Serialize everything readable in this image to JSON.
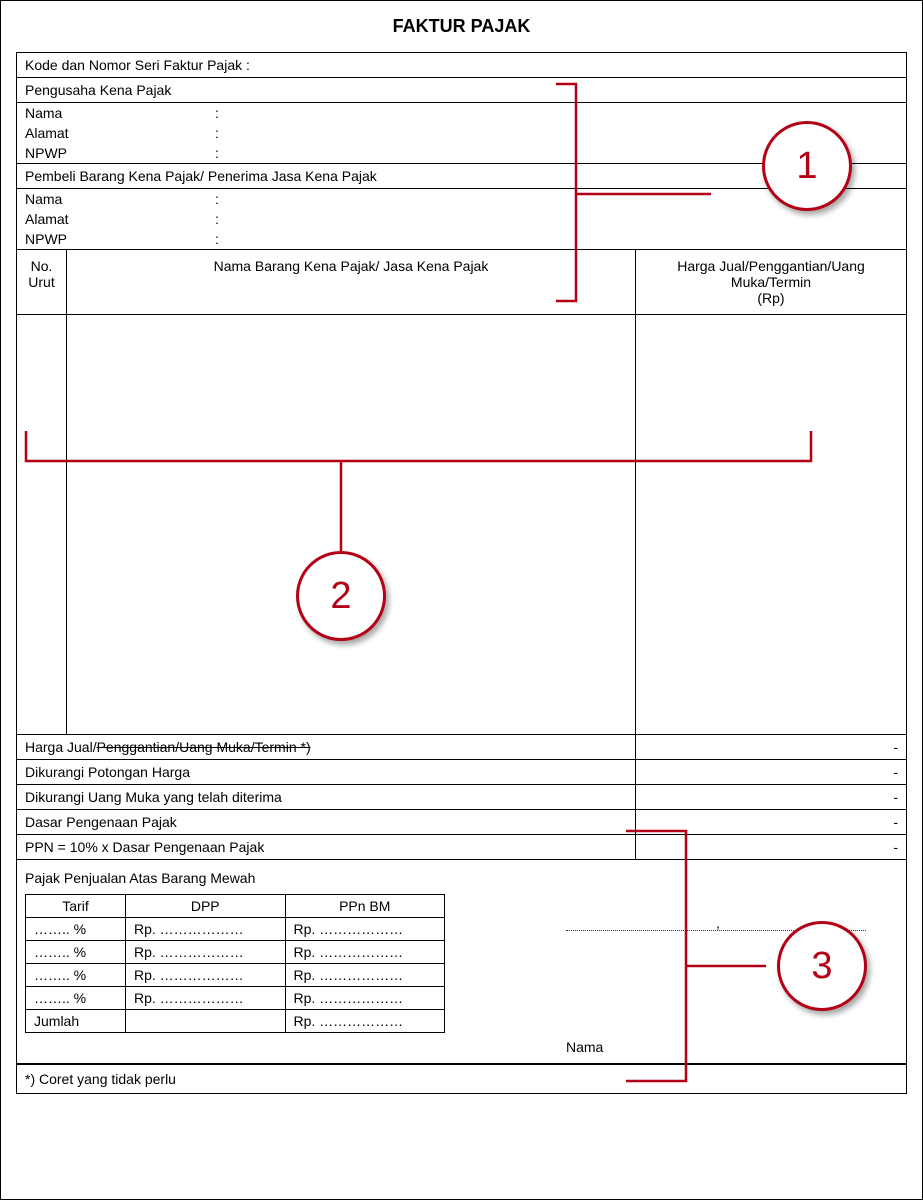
{
  "title": "FAKTUR PAJAK",
  "header": {
    "kode_label": "Kode dan Nomor Seri Faktur Pajak :",
    "pkp_section": "Pengusaha Kena Pajak",
    "pembeli_section": "Pembeli Barang Kena Pajak/ Penerima Jasa Kena Pajak",
    "nama_label": "Nama",
    "alamat_label": "Alamat",
    "npwp_label": "NPWP",
    "colon": ":"
  },
  "items": {
    "col_no": "No. Urut",
    "col_name": "Nama Barang Kena Pajak/ Jasa Kena Pajak",
    "col_price": "Harga Jual/Penggantian/Uang Muka/Termin\n(Rp)"
  },
  "summary": {
    "r1a": "Harga Jual/",
    "r1b": "Penggantian/Uang Muka/Termin *)",
    "r2": "Dikurangi Potongan Harga",
    "r3": "Dikurangi Uang Muka yang telah diterima",
    "r4": "Dasar Pengenaan Pajak",
    "r5": "PPN = 10% x Dasar Pengenaan Pajak",
    "dash": "-"
  },
  "ppnbm": {
    "title": "Pajak Penjualan Atas Barang Mewah",
    "col_tarif": "Tarif",
    "col_dpp": "DPP",
    "col_ppnbm": "PPn BM",
    "tarif_row": "…….. %",
    "rp_row": "Rp. ………………",
    "jumlah": "Jumlah"
  },
  "signature": {
    "comma": ",",
    "nama_label": "Nama"
  },
  "footnote": "*) Coret yang tidak perlu",
  "annotations": {
    "one": "1",
    "two": "2",
    "three": "3"
  }
}
